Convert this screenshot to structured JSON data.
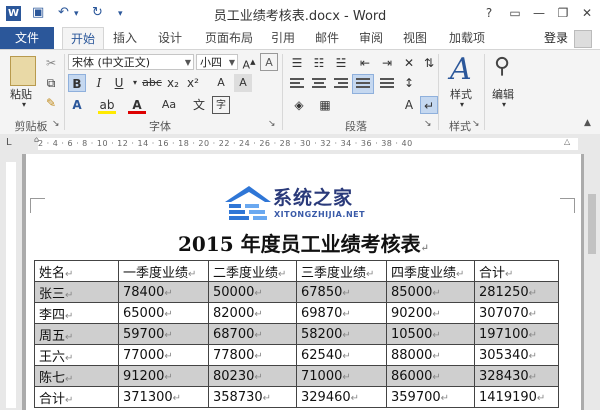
{
  "window": {
    "title": "员工业绩考核表.docx - Word",
    "app_icon_letter": "W",
    "controls": [
      "?",
      "▭",
      "—",
      "❐",
      "✕"
    ]
  },
  "tabs": {
    "file": "文件",
    "items": [
      "开始",
      "插入",
      "设计",
      "页面布局",
      "引用",
      "邮件",
      "审阅",
      "视图",
      "加载项"
    ],
    "active": "开始",
    "login": "登录"
  },
  "ribbon": {
    "clipboard": {
      "paste": "粘贴",
      "label": "剪贴板"
    },
    "font": {
      "name": "宋体 (中文正文)",
      "size": "小四",
      "label": "字体",
      "buttons": [
        "B",
        "I",
        "U",
        "abc",
        "x₂",
        "x²",
        "A",
        "A",
        "Aa",
        "A",
        "A"
      ]
    },
    "paragraph": {
      "label": "段落"
    },
    "styles": {
      "button": "样式",
      "label": "样式"
    },
    "editing": {
      "button": "编辑"
    }
  },
  "ruler": {
    "ticks": "2  · 4  · 6  · 8  · 10 · 12 · 14 · 16 · 18 · 20 · 22 · 24 · 26 · 28 · 30 · 32 · 34 · 36 · 38 · 40"
  },
  "watermark": {
    "main": "系统之家",
    "sub": "XITONGZHIJIA.NET"
  },
  "document": {
    "title": "2015 年度员工业绩考核表",
    "para_mark": "↵",
    "table": {
      "headers": [
        "姓名",
        "一季度业绩",
        "二季度业绩",
        "三季度业绩",
        "四季度业绩",
        "合计"
      ],
      "rows": [
        [
          "张三",
          "78400",
          "50000",
          "67850",
          "85000",
          "281250"
        ],
        [
          "李四",
          "65000",
          "82000",
          "69870",
          "90200",
          "307070"
        ],
        [
          "周五",
          "59700",
          "68700",
          "58200",
          "10500",
          "197100"
        ],
        [
          "王六",
          "77000",
          "77800",
          "62540",
          "88000",
          "305340"
        ],
        [
          "陈七",
          "91200",
          "80230",
          "71000",
          "86000",
          "328430"
        ],
        [
          "合计",
          "371300",
          "358730",
          "329460",
          "359700",
          "1419190"
        ]
      ],
      "shaded_rows": [
        0,
        2,
        4
      ]
    }
  },
  "colors": {
    "accent": "#2b579a",
    "shade": "#cfcfcf",
    "workspace": "#ababab"
  }
}
